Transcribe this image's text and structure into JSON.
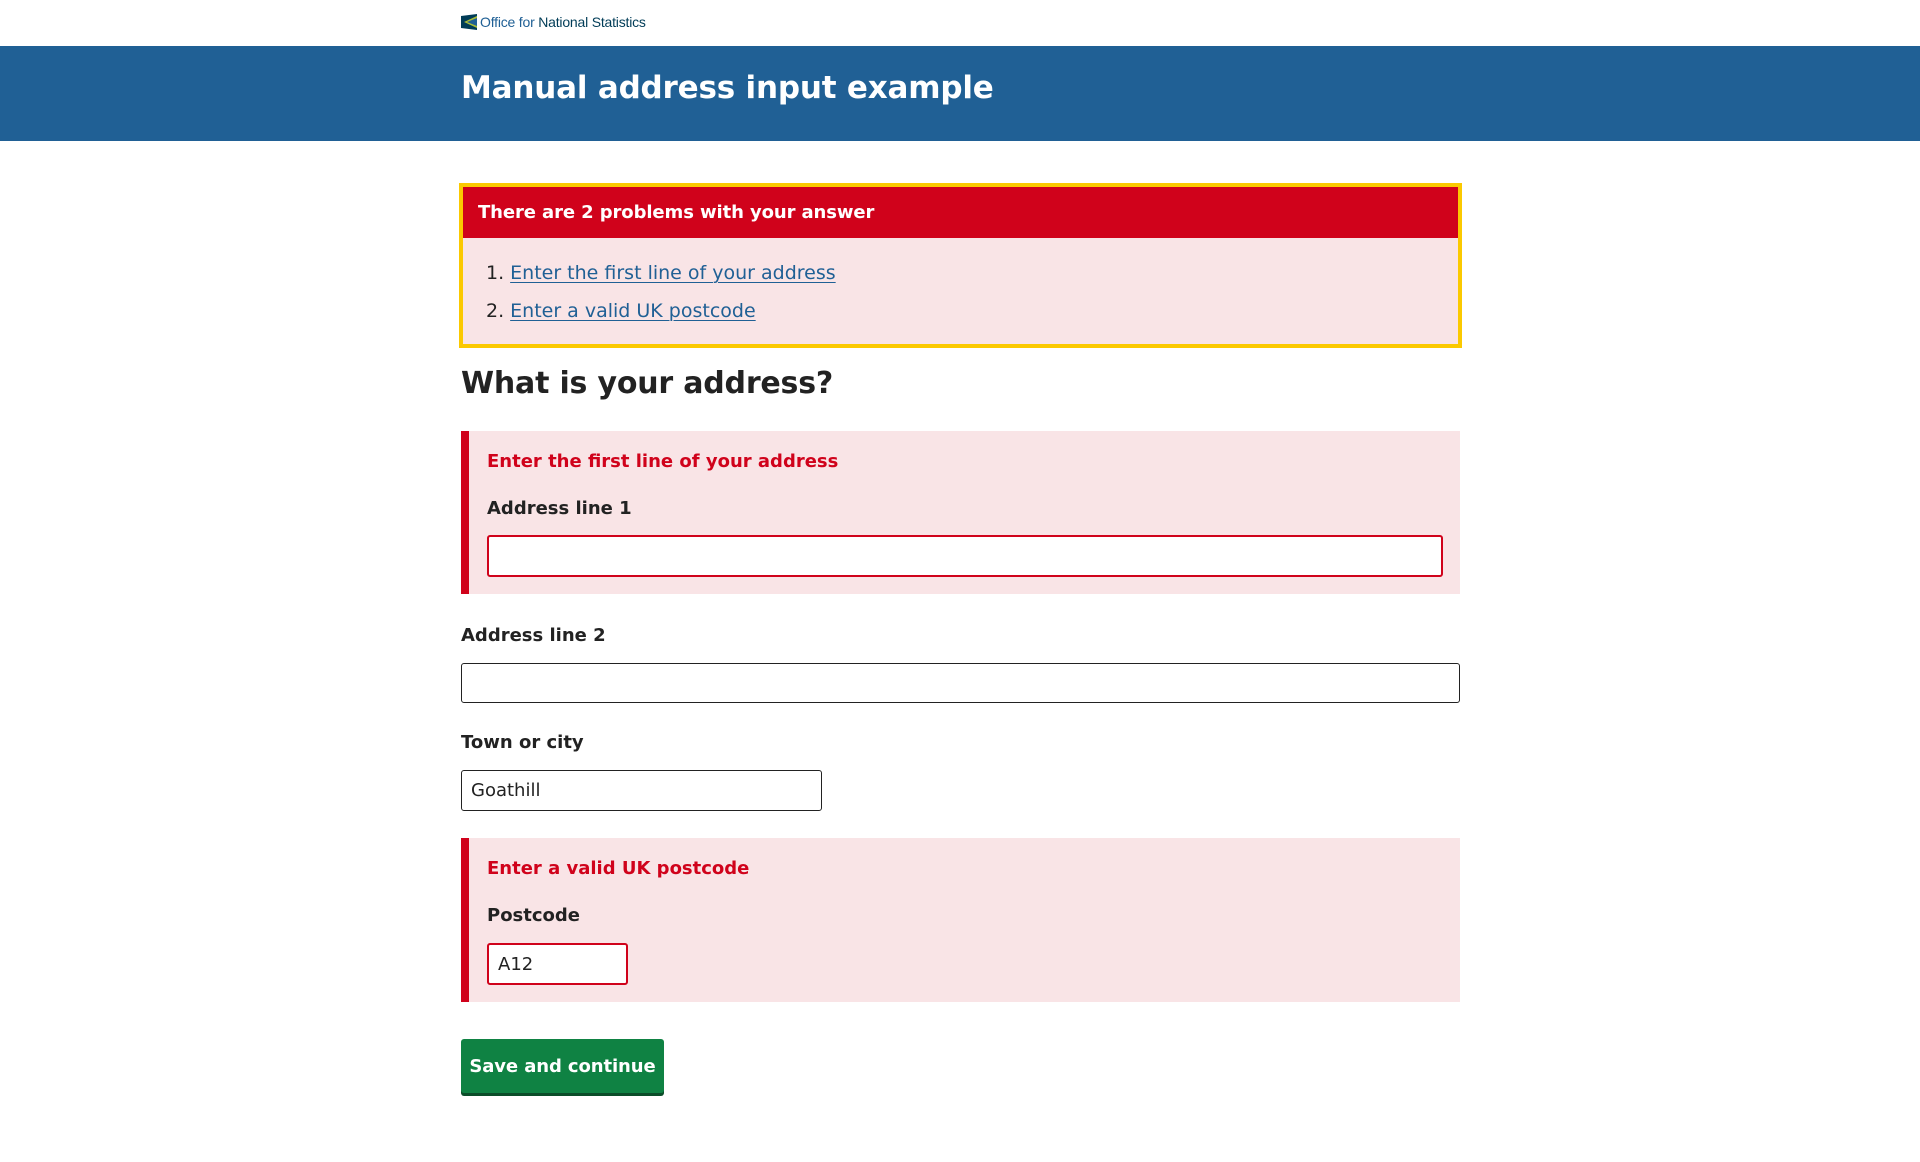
{
  "brand": {
    "logo_text_regular": "Office for",
    "logo_text_bold": "National Statistics",
    "colors": {
      "primary": "#206095",
      "error": "#d0021b",
      "focus": "#fbc900",
      "button": "#0f8243"
    }
  },
  "header": {
    "title": "Manual address input example"
  },
  "error_summary": {
    "title": "There are 2 problems with your answer",
    "items": [
      {
        "number": "1.",
        "text": "Enter the first line of your address"
      },
      {
        "number": "2.",
        "text": "Enter a valid UK postcode"
      }
    ]
  },
  "question": {
    "title": "What is your address?"
  },
  "fields": {
    "address_line1": {
      "error": "Enter the first line of your address",
      "label": "Address line 1",
      "value": ""
    },
    "address_line2": {
      "label": "Address line 2",
      "value": ""
    },
    "town": {
      "label": "Town or city",
      "value": "Goathill"
    },
    "postcode": {
      "error": "Enter a valid UK postcode",
      "label": "Postcode",
      "value": "A12"
    }
  },
  "actions": {
    "save_label": "Save and continue"
  }
}
